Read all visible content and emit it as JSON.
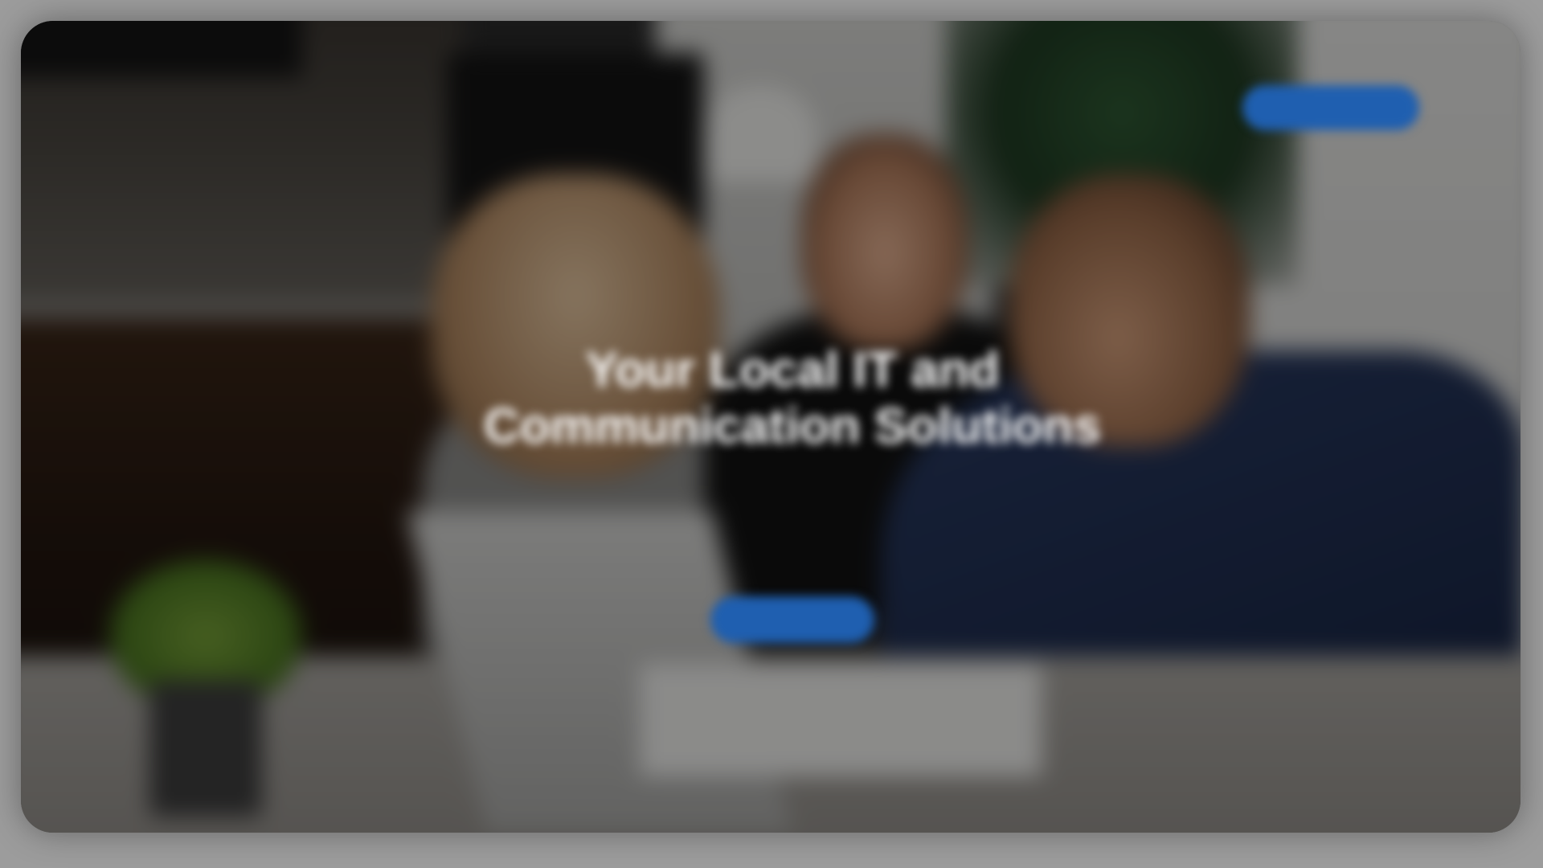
{
  "hero": {
    "headline_line1": "Your Local IT and",
    "headline_line2": "Communication Solutions",
    "subtext": "",
    "cta_label": "",
    "header_button_label": ""
  },
  "colors": {
    "accent": "#1f5fb0",
    "frame": "#9c9c9c",
    "headline": "#ffffff"
  },
  "background_photo": "blurred-office-meeting-photo"
}
